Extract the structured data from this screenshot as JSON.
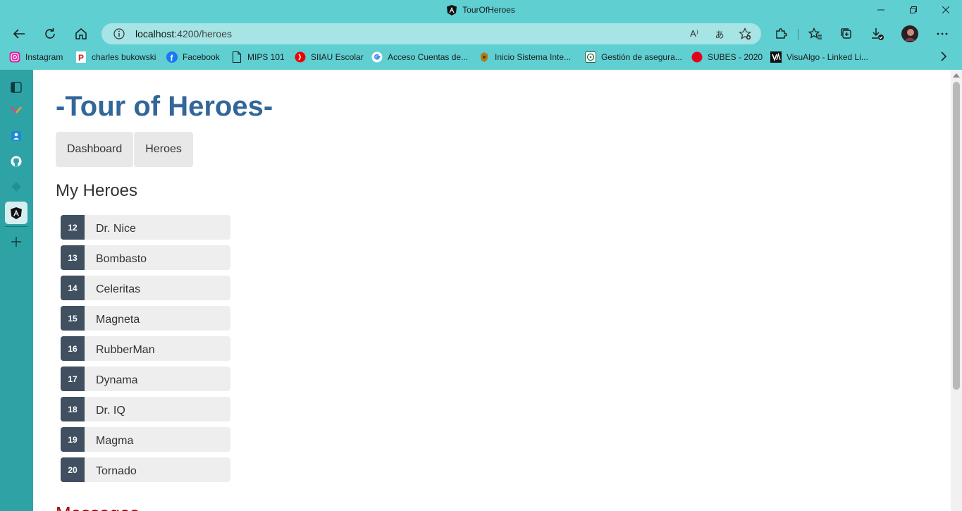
{
  "window": {
    "title": "TourOfHeroes"
  },
  "browser": {
    "url_host": "localhost",
    "url_path": ":4200/heroes"
  },
  "bookmarks": [
    {
      "label": "Instagram",
      "icon": "instagram-icon"
    },
    {
      "label": "charles bukowski",
      "icon": "pinterest-icon"
    },
    {
      "label": "Facebook",
      "icon": "facebook-icon"
    },
    {
      "label": "MIPS 101",
      "icon": "page-icon"
    },
    {
      "label": "SIIAU Escolar",
      "icon": "siiau-icon"
    },
    {
      "label": "Acceso  Cuentas de...",
      "icon": "google-icon"
    },
    {
      "label": "Inicio   Sistema Inte...",
      "icon": "crest-icon"
    },
    {
      "label": "Gestión de asegura...",
      "icon": "imss-icon"
    },
    {
      "label": "SUBES - 2020",
      "icon": "red-circle-icon"
    },
    {
      "label": "VisuAlgo - Linked Li...",
      "icon": "visualgo-icon"
    }
  ],
  "app": {
    "title": "-Tour of Heroes-",
    "nav": [
      {
        "label": "Dashboard"
      },
      {
        "label": "Heroes"
      }
    ],
    "section_title": "My Heroes",
    "heroes": [
      {
        "id": "12",
        "name": "Dr. Nice"
      },
      {
        "id": "13",
        "name": "Bombasto"
      },
      {
        "id": "14",
        "name": "Celeritas"
      },
      {
        "id": "15",
        "name": "Magneta"
      },
      {
        "id": "16",
        "name": "RubberMan"
      },
      {
        "id": "17",
        "name": "Dynama"
      },
      {
        "id": "18",
        "name": "Dr. IQ"
      },
      {
        "id": "19",
        "name": "Magma"
      },
      {
        "id": "20",
        "name": "Tornado"
      }
    ],
    "messages_title": "Messages"
  },
  "colors": {
    "chrome": "#5fcfd2",
    "sidebar": "#2ea3a6",
    "title": "#336699",
    "badge": "#405061"
  }
}
